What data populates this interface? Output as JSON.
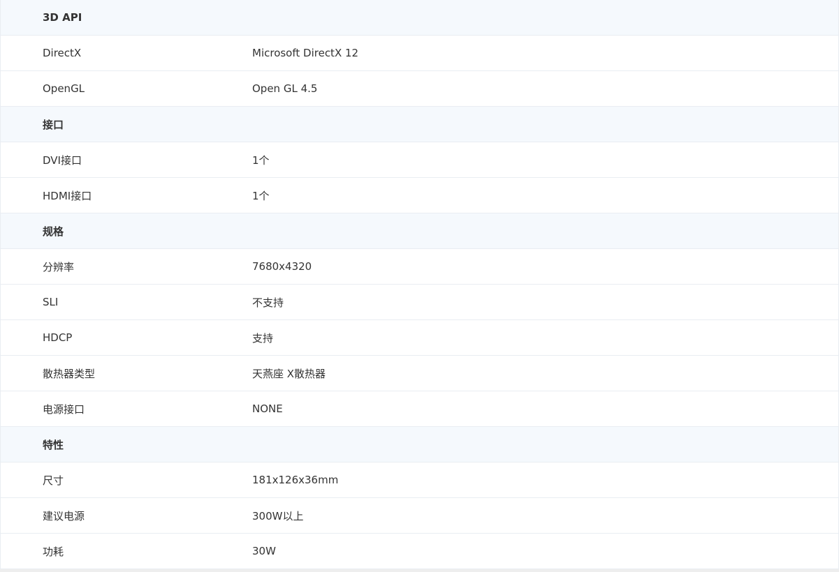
{
  "sections": [
    {
      "title": "3D API",
      "rows": [
        {
          "label": "DirectX",
          "value": "Microsoft DirectX 12"
        },
        {
          "label": "OpenGL",
          "value": "Open GL 4.5"
        }
      ]
    },
    {
      "title": "接口",
      "rows": [
        {
          "label": "DVI接口",
          "value": "1个"
        },
        {
          "label": "HDMI接口",
          "value": "1个"
        }
      ]
    },
    {
      "title": "规格",
      "rows": [
        {
          "label": "分辨率",
          "value": "7680x4320"
        },
        {
          "label": "SLI",
          "value": "不支持"
        },
        {
          "label": "HDCP",
          "value": "支持"
        },
        {
          "label": "散热器类型",
          "value": "天燕座 X散热器"
        },
        {
          "label": "电源接口",
          "value": "NONE"
        }
      ]
    },
    {
      "title": "特性",
      "rows": [
        {
          "label": "尺寸",
          "value": "181x126x36mm"
        },
        {
          "label": "建议电源",
          "value": "300W以上"
        },
        {
          "label": "功耗",
          "value": "30W"
        }
      ]
    }
  ]
}
